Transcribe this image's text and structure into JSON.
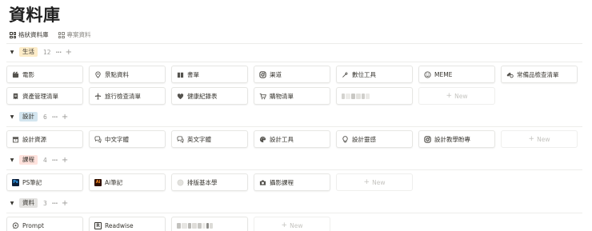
{
  "title": "資料庫",
  "views": [
    {
      "label": "格狀資料庫",
      "active": true
    },
    {
      "label": "專案資料",
      "active": false
    }
  ],
  "groups": [
    {
      "label": "生活",
      "count": "12",
      "badge_color": "#fdecc8",
      "cards": [
        {
          "label": "電影",
          "icon": "film-icon"
        },
        {
          "label": "景點資料",
          "icon": "location-pin-icon"
        },
        {
          "label": "書單",
          "icon": "book-icon"
        },
        {
          "label": "渠道",
          "icon": "instagram-icon"
        },
        {
          "label": "數位工具",
          "icon": "wrench-icon"
        },
        {
          "label": "MEME",
          "icon": "smiley-icon"
        },
        {
          "label": "常備品檢查清單",
          "icon": "pills-icon"
        },
        {
          "label": "資產管理清單",
          "icon": "receipt-icon"
        },
        {
          "label": "旅行檢查清單",
          "icon": "airplane-icon"
        },
        {
          "label": "健康紀錄表",
          "icon": "heart-icon"
        },
        {
          "label": "購物清單",
          "icon": "cart-icon"
        },
        {
          "label": "",
          "icon": "redacted"
        }
      ],
      "new_label": "New"
    },
    {
      "label": "設計",
      "count": "6",
      "badge_color": "#d3e5ef",
      "cards": [
        {
          "label": "設計資源",
          "icon": "archive-icon"
        },
        {
          "label": "中文字體",
          "icon": "chat-icon"
        },
        {
          "label": "英文字體",
          "icon": "chat-icon"
        },
        {
          "label": "設計工具",
          "icon": "palette-icon"
        },
        {
          "label": "設計靈感",
          "icon": "bulb-icon"
        },
        {
          "label": "設計教學盼專",
          "icon": "instagram-icon"
        }
      ],
      "new_label": "New"
    },
    {
      "label": "課程",
      "count": "4",
      "badge_color": "#ffe2dd",
      "cards": [
        {
          "label": "PS筆記",
          "icon": "photoshop-icon",
          "badge": "Ps"
        },
        {
          "label": "Ai筆記",
          "icon": "illustrator-icon",
          "badge": "Ai"
        },
        {
          "label": "排版基本學",
          "icon": "circle-icon"
        },
        {
          "label": "攝影課程",
          "icon": "camera-icon"
        }
      ],
      "new_label": "New"
    },
    {
      "label": "資料",
      "count": "3",
      "badge_color": "#e3e2e0",
      "cards": [
        {
          "label": "Prompt",
          "icon": "speech-bubble-icon"
        },
        {
          "label": "Readwise",
          "icon": "readwise-icon",
          "badge": "R"
        },
        {
          "label": "",
          "icon": "redacted"
        }
      ],
      "new_label": "New"
    }
  ]
}
